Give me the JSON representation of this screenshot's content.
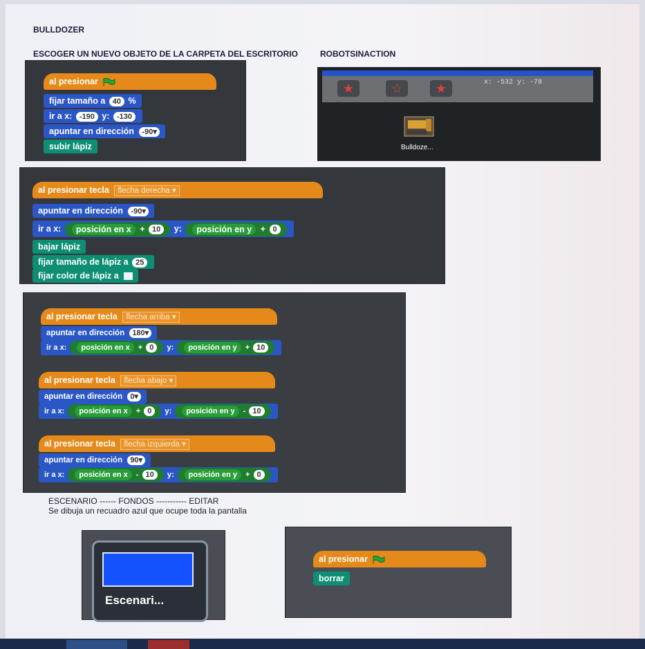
{
  "document": {
    "title": "BULLDOZER",
    "subtitle_a": "ESCOGER UN NUEVO OBJETO DE LA CARPETA DEL ESCRITORIO",
    "subtitle_b": "ROBOTSINACTION",
    "note1": "ESCENARIO  ------ FONDOS ----------- EDITAR",
    "note2": "Se dibuja un recuadro azul que ocupe toda la pantalla"
  },
  "script1": {
    "hat": "al presionar",
    "size_label": "fijar tamaño a",
    "size_value": "40",
    "size_unit": "%",
    "goto_label": "ir a x:",
    "goto_x": "-190",
    "goto_y_label": "y:",
    "goto_y": "-130",
    "dir_label": "apuntar en dirección",
    "dir_value": "-90▾",
    "pen_up": "subir lápiz"
  },
  "sprite_panel": {
    "coords": "x: -532   y: -78",
    "sprite_name": "Bulldoze..."
  },
  "script2": {
    "hat": "al presionar tecla",
    "key": "flecha derecha ▾",
    "dir_label": "apuntar en dirección",
    "dir_value": "-90▾",
    "goto_label": "ir a x:",
    "posx": "posición en x",
    "plus": "+",
    "x_add": "10",
    "y_label": "y:",
    "posy": "posición en y",
    "y_add": "0",
    "pen_down": "bajar lápiz",
    "pen_size_label": "fijar tamaño de lápiz a",
    "pen_size": "25",
    "pen_color_label": "fijar color de lápiz a"
  },
  "script3": {
    "up": {
      "hat": "al presionar tecla",
      "key": "flecha arriba ▾",
      "dir_label": "apuntar en dirección",
      "dir_value": "180▾",
      "goto_label": "ir a x:",
      "posx": "posición en x",
      "op1": "+",
      "v1": "0",
      "y_label": "y:",
      "posy": "posición en y",
      "op2": "+",
      "v2": "10"
    },
    "down": {
      "hat": "al presionar tecla",
      "key": "flecha abajo ▾",
      "dir_label": "apuntar en dirección",
      "dir_value": "0▾",
      "goto_label": "ir a x:",
      "posx": "posición en x",
      "op1": "+",
      "v1": "0",
      "y_label": "y:",
      "posy": "posición en y",
      "op2": "-",
      "v2": "10"
    },
    "left": {
      "hat": "al presionar tecla",
      "key": "flecha izquierda ▾",
      "dir_label": "apuntar en dirección",
      "dir_value": "90▾",
      "goto_label": "ir a x:",
      "posx": "posición en x",
      "op1": "-",
      "v1": "10",
      "y_label": "y:",
      "posy": "posición en y",
      "op2": "+",
      "v2": "0"
    }
  },
  "stage_panel": {
    "label": "Escenari..."
  },
  "script4": {
    "hat": "al presionar",
    "clear": "borrar"
  },
  "colors": {
    "control": "#e58a1a",
    "motion": "#2b57c6",
    "pen": "#0e8f74",
    "operators": "#2b9f3b"
  },
  "icons": [
    "green-flag-icon",
    "paint-new-sprite-icon",
    "choose-sprite-icon",
    "surprise-sprite-icon"
  ]
}
